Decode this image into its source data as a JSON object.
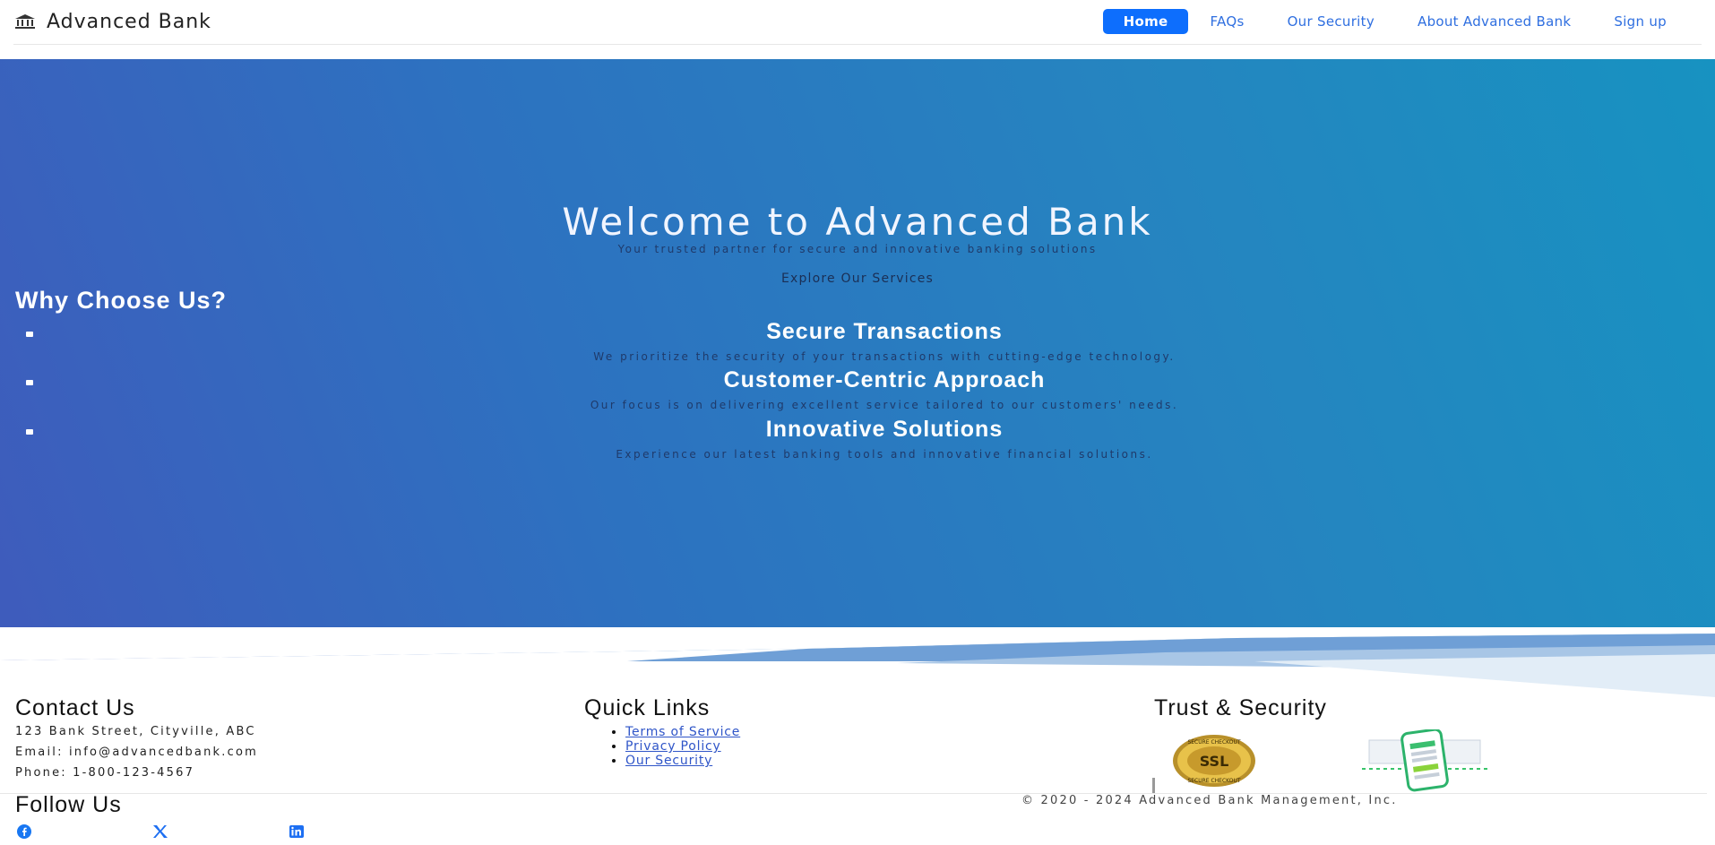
{
  "navbar": {
    "brand": "Advanced Bank",
    "brand_icon": "bank-icon",
    "links": [
      {
        "label": "Home",
        "active": true
      },
      {
        "label": "FAQs"
      },
      {
        "label": "Our Security"
      },
      {
        "label": "About Advanced Bank"
      },
      {
        "label": "Sign up"
      }
    ]
  },
  "hero": {
    "title": "Welcome to Advanced Bank",
    "subtitle": "Your trusted partner for secure and innovative banking solutions",
    "cta": "Explore Our Services",
    "why_title": "Why Choose Us?",
    "features": [
      {
        "title": "Secure Transactions",
        "desc": "We prioritize the security of your transactions with cutting-edge technology."
      },
      {
        "title": "Customer-Centric Approach",
        "desc": "Our focus is on delivering excellent service tailored to our customers' needs."
      },
      {
        "title": "Innovative Solutions",
        "desc": "Experience our latest banking tools and innovative financial solutions."
      }
    ]
  },
  "footer": {
    "contact": {
      "title": "Contact Us",
      "address": "123 Bank Street, Cityville, ABC",
      "email": "Email: info@advancedbank.com",
      "phone": "Phone: 1-800-123-4567"
    },
    "quick_links": {
      "title": "Quick Links",
      "items": [
        "Terms of Service",
        "Privacy Policy",
        "Our Security"
      ]
    },
    "trust": {
      "title": "Trust & Security",
      "badges": [
        "ssl-seal-icon",
        "verified-phone-icon"
      ],
      "ssl_top": "SECURE CHECKOUT",
      "ssl_mid": "SSL",
      "ssl_bottom": "SECURE CHECKOUT"
    },
    "follow": {
      "title": "Follow Us",
      "icons": [
        "facebook-icon",
        "x-icon",
        "linkedin-icon"
      ]
    },
    "copyright": "© 2020 - 2024 Advanced Bank Management, Inc."
  },
  "colors": {
    "accent": "#0d6efd",
    "hero_start": "#3f5bbc",
    "hero_end": "#1792c1"
  }
}
